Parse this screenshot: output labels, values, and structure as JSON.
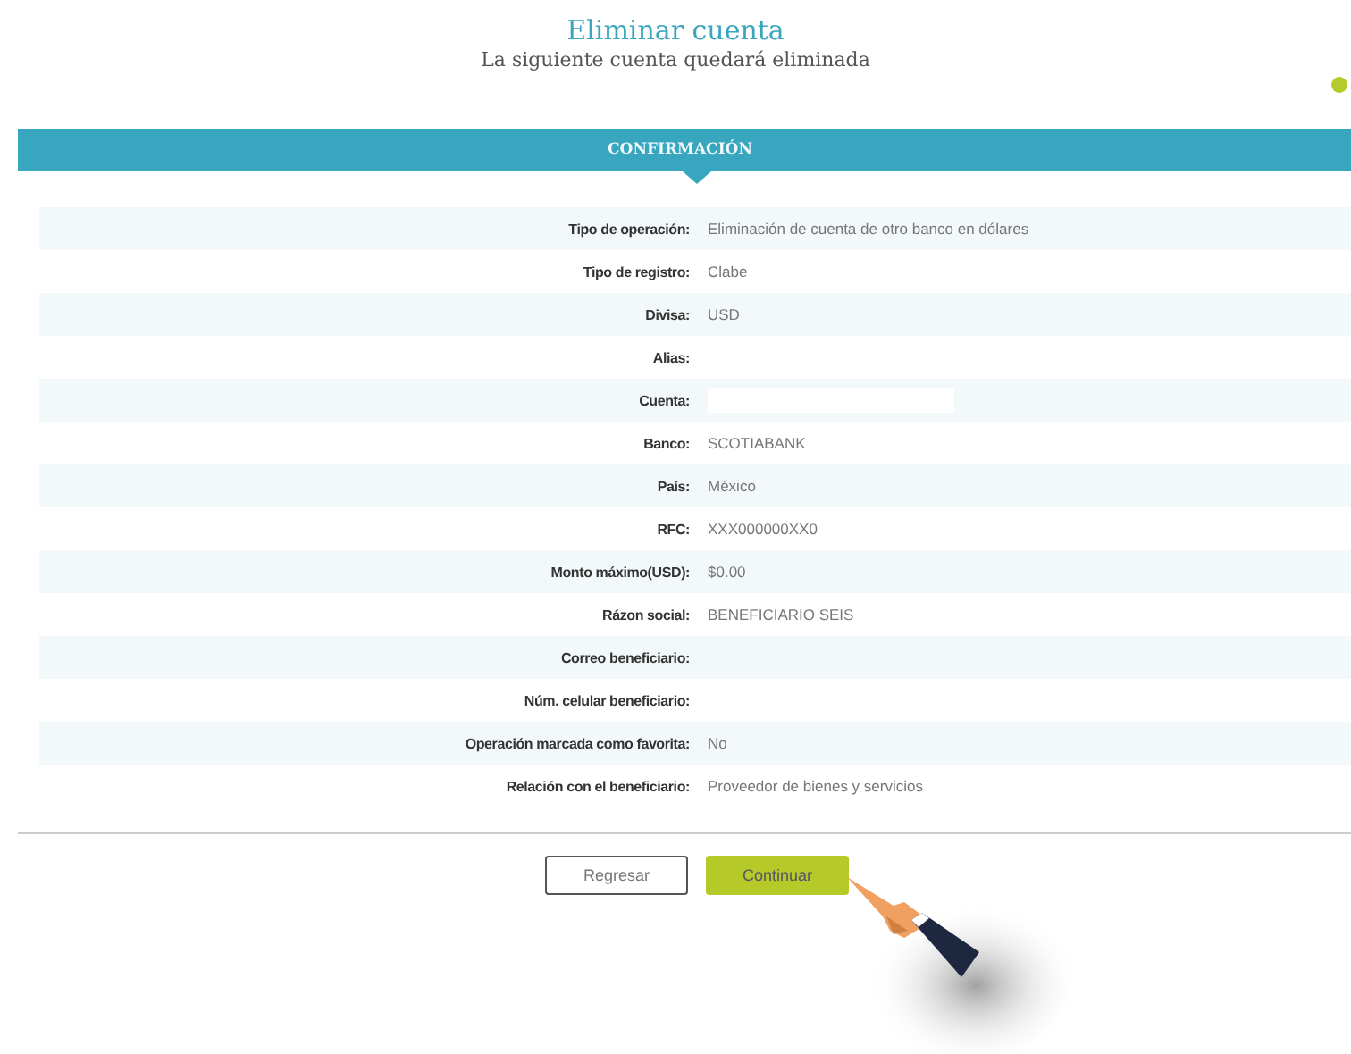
{
  "header": {
    "title": "Eliminar cuenta",
    "subtitle": "La siguiente cuenta quedará eliminada"
  },
  "section": {
    "title": "CONFIRMACIÓN"
  },
  "rows": [
    {
      "label": "Tipo de operación:",
      "value": "Eliminación de cuenta de otro banco en dólares"
    },
    {
      "label": "Tipo de registro:",
      "value": "Clabe"
    },
    {
      "label": "Divisa:",
      "value": "USD"
    },
    {
      "label": "Alias:"
    },
    {
      "label": "Cuenta:",
      "hidden": true
    },
    {
      "label": "Banco:",
      "value": "SCOTIABANK"
    },
    {
      "label": "País:",
      "value": "México"
    },
    {
      "label": "RFC:",
      "value": "XXX000000XX0"
    },
    {
      "label": "Monto máximo(USD):",
      "value": "$0.00"
    },
    {
      "label": "Rázon social:",
      "value": "BENEFICIARIO SEIS"
    },
    {
      "label": "Correo beneficiario:"
    },
    {
      "label": "Núm. celular beneficiario:"
    },
    {
      "label": "Operación marcada como favorita:",
      "value": "No"
    },
    {
      "label": "Relación con el beneficiario:",
      "value": "Proveedor de bienes y servicios"
    }
  ],
  "buttons": [
    {
      "label": "Regresar",
      "kind": "secondary"
    },
    {
      "label": "Continuar",
      "kind": "primary"
    }
  ]
}
